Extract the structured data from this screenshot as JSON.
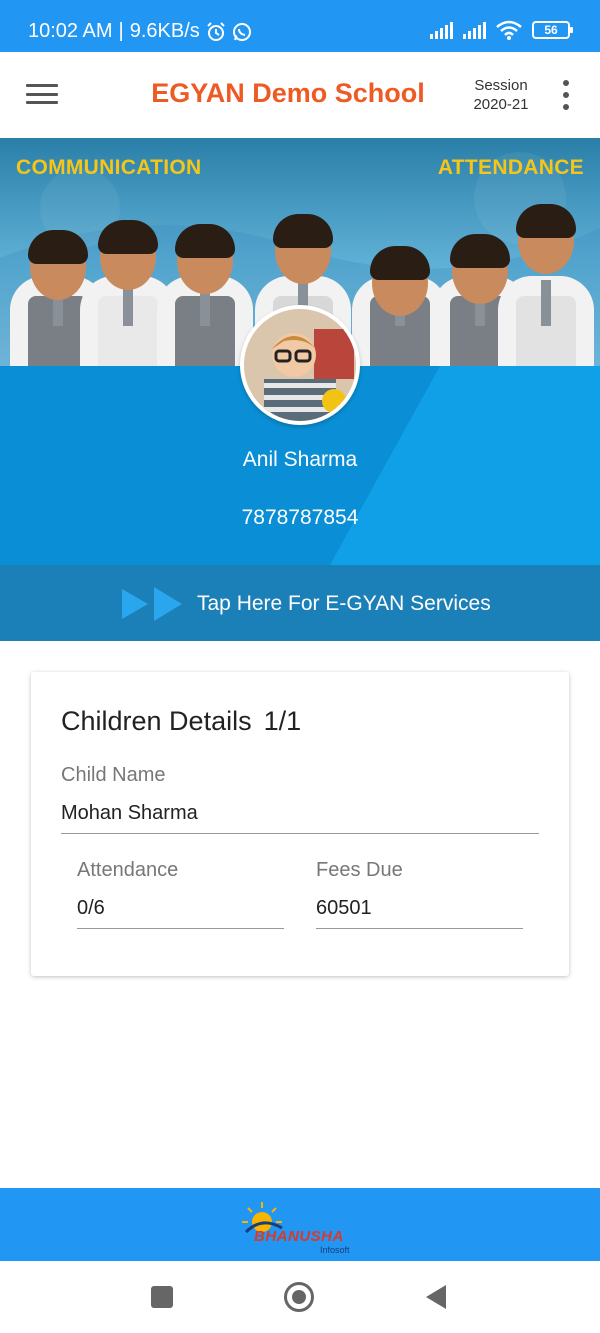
{
  "status_bar": {
    "time": "10:02 AM",
    "separator": "|",
    "speed": "9.6KB/s",
    "battery": "56",
    "icons": [
      "alarm-icon",
      "whatsapp-icon",
      "signal-icon",
      "signal-icon",
      "wifi-icon",
      "battery-icon"
    ]
  },
  "app_bar": {
    "title": "EGYAN Demo School",
    "session_label": "Session",
    "session_value": "2020-21",
    "title_color": "#ee5a24"
  },
  "banner": {
    "left_label": "COMMUNICATION",
    "right_label": "ATTENDANCE"
  },
  "profile": {
    "name": "Anil Sharma",
    "phone": "7878787854"
  },
  "services": {
    "label": "Tap Here For E-GYAN Services"
  },
  "children": {
    "title": "Children Details",
    "count": "1/1",
    "child_name_label": "Child Name",
    "child_name": "Mohan Sharma",
    "attendance_label": "Attendance",
    "attendance_value": "0/6",
    "fees_label": "Fees Due",
    "fees_value": "60501"
  },
  "footer": {
    "logo_text": "BHANUSHA",
    "logo_sub": "Infosoft"
  },
  "colors": {
    "status_bar": "#2196f3",
    "profile_bg": "#0fa0e8",
    "services_bg": "#1b7fb8",
    "footer_bg": "#2196f3",
    "accent_yellow": "#f5c518"
  }
}
